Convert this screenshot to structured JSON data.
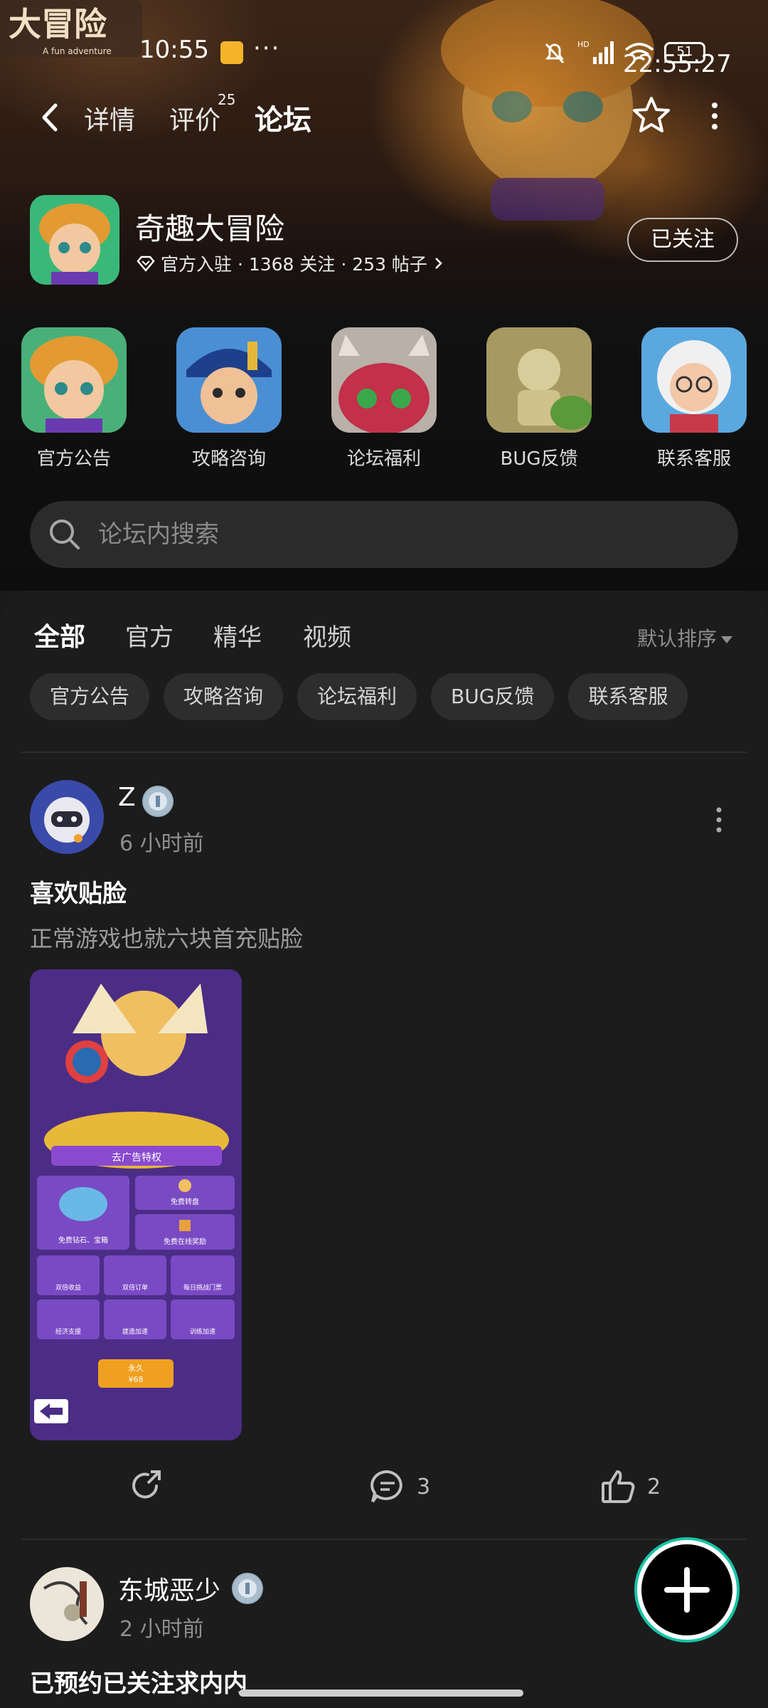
{
  "status_bar": {
    "time": "10:55",
    "extra_dots": "···",
    "clock": "22:55:27",
    "battery": "51",
    "network_label": "HD"
  },
  "brand": {
    "logo_text": "大冒险",
    "logo_sub": "A fun adventure"
  },
  "nav": {
    "back_icon": "chevron-left-icon",
    "tabs": [
      {
        "label": "详情",
        "active": false
      },
      {
        "label": "评价",
        "active": false,
        "count": "25"
      },
      {
        "label": "论坛",
        "active": true
      }
    ],
    "star_icon": "star-icon",
    "more_icon": "more-vertical-icon"
  },
  "game": {
    "name": "奇趣大冒险",
    "verified_icon": "diamond-verified-icon",
    "meta": "官方入驻 · 1368 关注 · 253 帖子",
    "follow_label": "已关注"
  },
  "categories": [
    {
      "label": "官方公告"
    },
    {
      "label": "攻略咨询"
    },
    {
      "label": "论坛福利"
    },
    {
      "label": "BUG反馈"
    },
    {
      "label": "联系客服"
    }
  ],
  "search": {
    "placeholder": "论坛内搜索"
  },
  "feed": {
    "tabs": [
      {
        "label": "全部",
        "active": true
      },
      {
        "label": "官方",
        "active": false
      },
      {
        "label": "精华",
        "active": false
      },
      {
        "label": "视频",
        "active": false
      }
    ],
    "sort_label": "默认排序",
    "chips": [
      "官方公告",
      "攻略咨询",
      "论坛福利",
      "BUG反馈",
      "联系客服"
    ]
  },
  "posts": [
    {
      "author": "Z",
      "time": "6 小时前",
      "title": "喜欢贴脸",
      "body": "正常游戏也就六块首充贴脸",
      "image": {
        "banner": "去广告特权",
        "cells": [
          "免费转盘",
          "免费钻石、宝箱",
          "免费在线奖励",
          "双倍收益",
          "双倍订单",
          "每日挑战门票",
          "经济支援",
          "建造加速",
          "训练加速"
        ],
        "price_top": "永久",
        "price": "¥68"
      },
      "comments": "3",
      "likes": "2"
    },
    {
      "author": "东城恶少",
      "time": "2 小时前",
      "title": "已预约已关注求内内"
    }
  ],
  "colors": {
    "accent": "#16c4a6",
    "bg": "#1c1c1c",
    "chip": "#2d2d2d"
  }
}
